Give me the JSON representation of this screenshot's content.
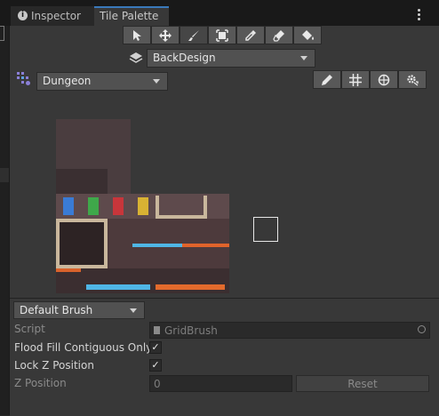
{
  "tabs": [
    {
      "label": "Inspector",
      "icon": "info-icon",
      "active": false
    },
    {
      "label": "Tile Palette",
      "active": true
    }
  ],
  "tools": [
    "select-tool",
    "move-tool",
    "paint-tool",
    "box-fill-tool",
    "picker-tool",
    "eraser-tool",
    "flood-fill-tool"
  ],
  "layer": {
    "value": "BackDesign"
  },
  "palette": {
    "value": "Dungeon"
  },
  "palette_tools": [
    "edit-palette",
    "toggle-grid",
    "gizmos",
    "palette-settings"
  ],
  "brush": {
    "value": "Default Brush"
  },
  "properties": {
    "script_label": "Script",
    "script_value": "GridBrush",
    "flood_fill_label": "Flood Fill Contiguous Only",
    "flood_fill_checked": true,
    "lock_z_label": "Lock Z Position",
    "lock_z_checked": true,
    "z_position_label": "Z Position",
    "z_position_value": "0",
    "reset_label": "Reset"
  },
  "colors": {
    "accent": "#3a79bb",
    "panel": "#383838",
    "tab_bar": "#191919"
  }
}
